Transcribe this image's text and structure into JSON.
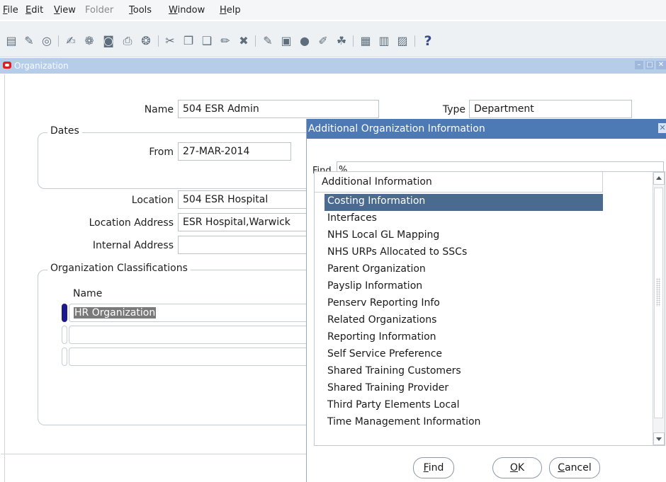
{
  "menu": {
    "items": [
      {
        "label": "File",
        "mnemonic": "F",
        "rest": "ile",
        "enabled": true
      },
      {
        "label": "Edit",
        "mnemonic": "E",
        "rest": "dit",
        "enabled": true
      },
      {
        "label": "View",
        "mnemonic": "V",
        "rest": "iew",
        "enabled": true
      },
      {
        "label": "Folder",
        "mnemonic": "",
        "rest": "Folder",
        "enabled": false
      },
      {
        "label": "Tools",
        "mnemonic": "T",
        "rest": "ools",
        "enabled": true
      },
      {
        "label": "Window",
        "mnemonic": "W",
        "rest": "indow",
        "enabled": true
      },
      {
        "label": "Help",
        "mnemonic": "H",
        "rest": "elp",
        "enabled": true
      }
    ]
  },
  "toolbar": {
    "icons": [
      "new-record-icon",
      "navigator-icon",
      "zoom-icon",
      "find-icon",
      "show-navigator-icon",
      "save-icon",
      "print-icon",
      "close-form-icon",
      "cut-icon",
      "copy-icon",
      "paste-icon",
      "clear-record-icon",
      "delete-record-icon",
      "edit-field-icon",
      "zoom-form-icon",
      "translations-icon",
      "attachments-icon",
      "folder-tools-icon",
      "calendar-icon",
      "schedule-icon",
      "exit-icon",
      "help-icon"
    ],
    "help_glyph": "?"
  },
  "window": {
    "title": "Organization",
    "accent": "#b6cde9"
  },
  "form": {
    "name_label": "Name",
    "name_value": "504 ESR Admin",
    "type_label": "Type",
    "type_value": "Department",
    "dates_title": "Dates",
    "from_label": "From",
    "from_value": "27-MAR-2014",
    "location_label": "Location",
    "location_value": "504 ESR Hospital",
    "location_address_label": "Location Address",
    "location_address_value": "ESR Hospital,Warwick",
    "internal_address_label": "Internal Address",
    "internal_address_value": "",
    "classifications_title": "Organization Classifications",
    "classifications_col_name": "Name",
    "classifications_rows": [
      "HR Organization",
      "",
      ""
    ]
  },
  "modal": {
    "title": "Additional Organization Information",
    "accent": "#4d79b4",
    "find_label": "Find",
    "find_value": "%",
    "list_header": "Additional Information",
    "items": [
      "Costing Information",
      "Interfaces",
      "NHS Local GL Mapping",
      "NHS URPs Allocated to SSCs",
      "Parent Organization",
      "Payslip Information",
      "Penserv Reporting Info",
      "Related Organizations",
      "Reporting Information",
      "Self Service Preference",
      "Shared Training Customers",
      "Shared Training Provider",
      "Third Party Elements Local",
      "Time Management Information"
    ],
    "selected_index": 0,
    "buttons": {
      "find_mnemonic": "F",
      "find_rest": "ind",
      "ok_mnemonic": "O",
      "ok_rest": "K",
      "cancel_mnemonic": "C",
      "cancel_rest": "ancel"
    }
  }
}
